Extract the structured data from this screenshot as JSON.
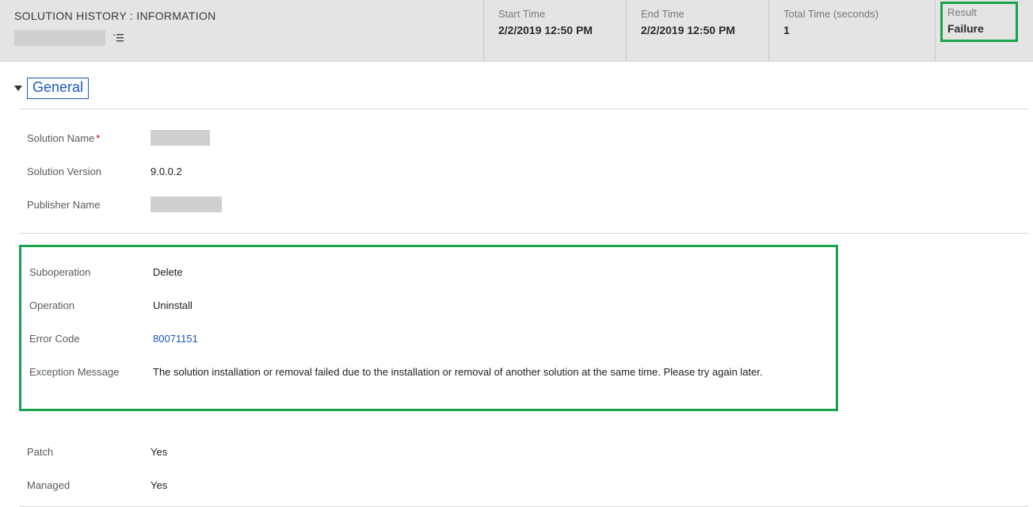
{
  "header": {
    "title": "SOLUTION HISTORY : INFORMATION",
    "startTime": {
      "label": "Start Time",
      "value": "2/2/2019  12:50 PM"
    },
    "endTime": {
      "label": "End Time",
      "value": "2/2/2019  12:50 PM"
    },
    "totalTime": {
      "label": "Total Time (seconds)",
      "value": "1"
    },
    "result": {
      "label": "Result",
      "value": "Failure"
    }
  },
  "section": {
    "title": "General"
  },
  "general": {
    "solutionName": {
      "label": "Solution Name"
    },
    "solutionVersion": {
      "label": "Solution Version",
      "value": "9.0.0.2"
    },
    "publisherName": {
      "label": "Publisher Name"
    }
  },
  "details": {
    "suboperation": {
      "label": "Suboperation",
      "value": "Delete"
    },
    "operation": {
      "label": "Operation",
      "value": "Uninstall"
    },
    "errorCode": {
      "label": "Error Code",
      "value": "80071151"
    },
    "exceptionMessage": {
      "label": "Exception Message",
      "value": "The solution installation or removal failed due to the installation or removal of another solution at the same time. Please try again later."
    }
  },
  "extra": {
    "patch": {
      "label": "Patch",
      "value": "Yes"
    },
    "managed": {
      "label": "Managed",
      "value": "Yes"
    }
  }
}
